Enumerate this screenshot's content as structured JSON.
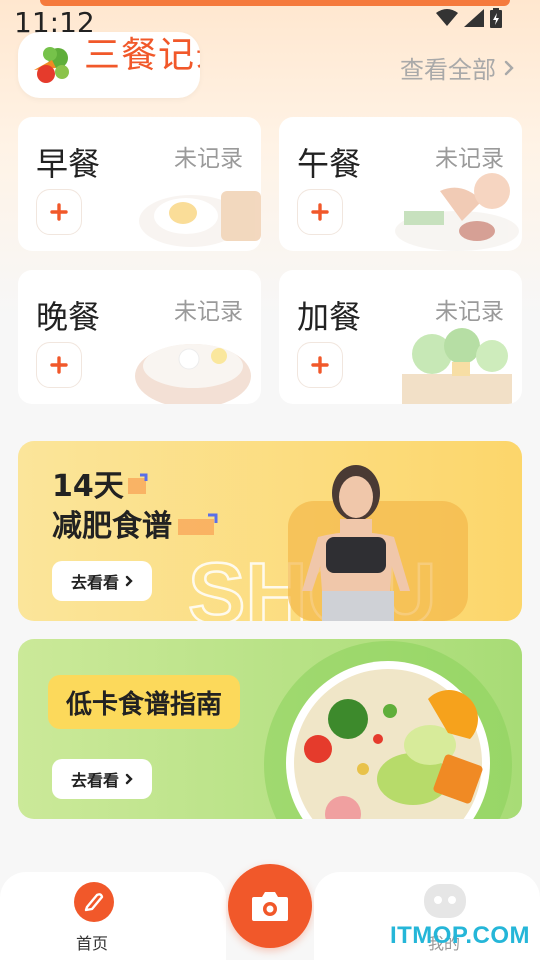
{
  "status_bar": {
    "time": "11:12"
  },
  "header": {
    "title": "三餐记录",
    "view_all": "查看全部"
  },
  "meals": [
    {
      "name": "早餐",
      "status": "未记录"
    },
    {
      "name": "午餐",
      "status": "未记录"
    },
    {
      "name": "晚餐",
      "status": "未记录"
    },
    {
      "name": "加餐",
      "status": "未记录"
    }
  ],
  "banners": {
    "recipe": {
      "line1": "14天",
      "line2": "减肥食谱",
      "bg_word": "SHOU",
      "button": "去看看"
    },
    "guide": {
      "label": "低卡食谱指南",
      "button": "去看看"
    }
  },
  "tabbar": {
    "home": "首页",
    "mine": "我的"
  },
  "watermark": "ITMOP.COM",
  "colors": {
    "accent": "#f1582a",
    "banner_yellow": "#fcd66b",
    "banner_green": "#a8dc76"
  },
  "icons": [
    "wifi-icon",
    "signal-icon",
    "battery-icon",
    "vegetables-icon",
    "chevron-right-icon",
    "plus-icon",
    "pen-icon",
    "camera-icon",
    "face-icon"
  ]
}
